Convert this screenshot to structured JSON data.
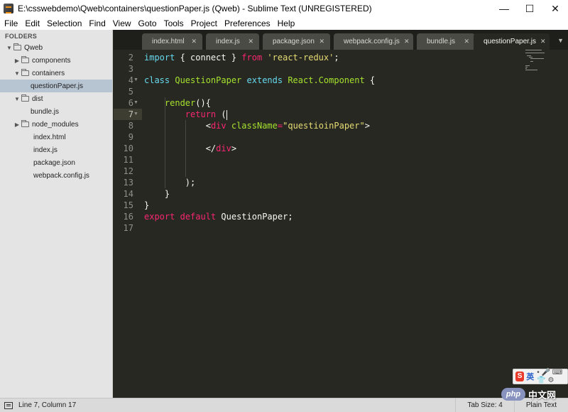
{
  "window": {
    "title": "E:\\csswebdemo\\Qweb\\containers\\questionPaper.js (Qweb) - Sublime Text (UNREGISTERED)",
    "minimize": "—",
    "maximize": "☐",
    "close": "✕"
  },
  "menu": [
    "File",
    "Edit",
    "Selection",
    "Find",
    "View",
    "Goto",
    "Tools",
    "Project",
    "Preferences",
    "Help"
  ],
  "sidebar": {
    "header": "FOLDERS",
    "items": [
      {
        "label": "Qweb",
        "type": "folder",
        "expanded": true
      },
      {
        "label": "components",
        "type": "folder",
        "expanded": false
      },
      {
        "label": "containers",
        "type": "folder",
        "expanded": true
      },
      {
        "label": "questionPaper.js",
        "type": "file",
        "selected": true
      },
      {
        "label": "dist",
        "type": "folder",
        "expanded": true
      },
      {
        "label": "bundle.js",
        "type": "file"
      },
      {
        "label": "node_modules",
        "type": "folder",
        "expanded": false
      },
      {
        "label": "index.html",
        "type": "file"
      },
      {
        "label": "index.js",
        "type": "file"
      },
      {
        "label": "package.json",
        "type": "file"
      },
      {
        "label": "webpack.config.js",
        "type": "file"
      }
    ]
  },
  "tabs": [
    {
      "label": "index.html",
      "active": false
    },
    {
      "label": "index.js",
      "active": false
    },
    {
      "label": "package.json",
      "active": false
    },
    {
      "label": "webpack.config.js",
      "active": false
    },
    {
      "label": "bundle.js",
      "active": false
    },
    {
      "label": "questionPaper.js",
      "active": true
    }
  ],
  "tab_close_glyph": "✕",
  "tab_overflow_glyph": "▼",
  "editor": {
    "current_line": 7,
    "lines": [
      {
        "n": "2",
        "tokens": [
          [
            "import",
            "#66d9ef"
          ],
          [
            " { connect } ",
            "#f8f8f2"
          ],
          [
            "from",
            "#f92672"
          ],
          [
            " ",
            "#f8f8f2"
          ],
          [
            "'react-redux'",
            "#e6db74"
          ],
          [
            ";",
            "#f8f8f2"
          ]
        ]
      },
      {
        "n": "3",
        "tokens": []
      },
      {
        "n": "4",
        "fold": true,
        "tokens": [
          [
            "class",
            "#66d9ef"
          ],
          [
            " ",
            "#f8f8f2"
          ],
          [
            "QuestionPaper",
            "#a6e22e"
          ],
          [
            " ",
            "#f8f8f2"
          ],
          [
            "extends",
            "#66d9ef"
          ],
          [
            " ",
            "#f8f8f2"
          ],
          [
            "React.Component",
            "#a6e22e"
          ],
          [
            " {",
            "#f8f8f2"
          ]
        ]
      },
      {
        "n": "5",
        "tokens": []
      },
      {
        "n": "6",
        "fold": true,
        "tokens": [
          [
            "    ",
            "#f8f8f2"
          ],
          [
            "render",
            "#a6e22e"
          ],
          [
            "(){",
            "#f8f8f2"
          ]
        ]
      },
      {
        "n": "7",
        "fold": true,
        "tokens": [
          [
            "        ",
            "#f8f8f2"
          ],
          [
            "return",
            "#f92672"
          ],
          [
            " (",
            "#f8f8f2"
          ]
        ],
        "caret": true
      },
      {
        "n": "8",
        "tokens": [
          [
            "            ",
            "#f8f8f2"
          ],
          [
            "<",
            "#f8f8f2"
          ],
          [
            "div",
            "#f92672"
          ],
          [
            " ",
            "#f8f8f2"
          ],
          [
            "className",
            "#a6e22e"
          ],
          [
            "=",
            "#f92672"
          ],
          [
            "\"questioinPaper\"",
            "#e6db74"
          ],
          [
            ">",
            "#f8f8f2"
          ]
        ]
      },
      {
        "n": "9",
        "tokens": []
      },
      {
        "n": "10",
        "tokens": [
          [
            "            ",
            "#f8f8f2"
          ],
          [
            "</",
            "#f8f8f2"
          ],
          [
            "div",
            "#f92672"
          ],
          [
            ">",
            "#f8f8f2"
          ]
        ]
      },
      {
        "n": "11",
        "tokens": []
      },
      {
        "n": "12",
        "tokens": []
      },
      {
        "n": "13",
        "tokens": [
          [
            "        );",
            "#f8f8f2"
          ]
        ]
      },
      {
        "n": "14",
        "tokens": [
          [
            "    }",
            "#f8f8f2"
          ]
        ]
      },
      {
        "n": "15",
        "tokens": [
          [
            "}",
            "#f8f8f2"
          ]
        ]
      },
      {
        "n": "16",
        "tokens": [
          [
            "export",
            "#f92672"
          ],
          [
            " ",
            "#f8f8f2"
          ],
          [
            "default",
            "#f92672"
          ],
          [
            " QuestionPaper;",
            "#f8f8f2"
          ]
        ]
      },
      {
        "n": "17",
        "tokens": []
      }
    ]
  },
  "status": {
    "position": "Line 7, Column 17",
    "tab_size": "Tab Size: 4",
    "syntax": "Plain Text"
  },
  "ime": {
    "logo": "S",
    "lang": "英",
    "symbols": "• 🎤 ⌨ 👕 ⚙"
  },
  "watermark": {
    "logo": "php",
    "text": "中文网"
  },
  "colors": {
    "editor_bg": "#272822",
    "sidebar_bg": "#e4e4e4",
    "selected_row": "#b7c4d2",
    "keyword": "#66d9ef",
    "string": "#e6db74",
    "tag": "#f92672",
    "entity": "#a6e22e"
  }
}
